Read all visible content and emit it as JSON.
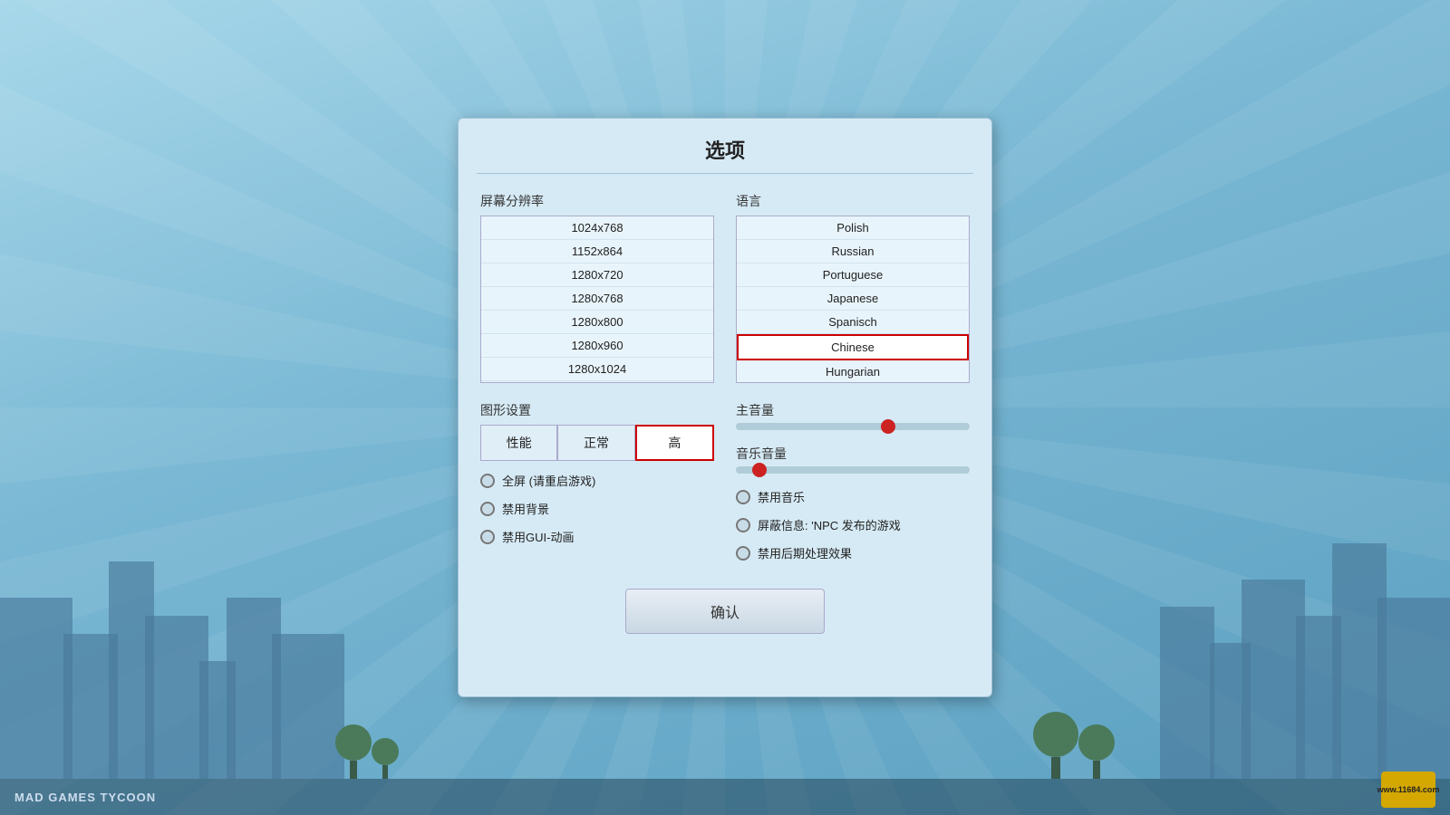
{
  "app": {
    "title": "MAD GAMES TYCOON",
    "watermark": "www.11684.com"
  },
  "dialog": {
    "title": "选项",
    "resolution_label": "屏幕分辨率",
    "language_label": "语言",
    "graphics_label": "图形设置",
    "master_volume_label": "主音量",
    "music_volume_label": "音乐音量",
    "confirm_label": "确认",
    "resolutions": [
      "1024x768",
      "1152x864",
      "1280x720",
      "1280x768",
      "1280x800",
      "1280x960",
      "1280x1024"
    ],
    "languages": [
      "Polish",
      "Russian",
      "Portuguese",
      "Japanese",
      "Spanisch",
      "Chinese",
      "Hungarian"
    ],
    "selected_language": "Chinese",
    "graphics_buttons": [
      {
        "label": "性能",
        "active": false
      },
      {
        "label": "正常",
        "active": false
      },
      {
        "label": "高",
        "active": true
      }
    ],
    "checkboxes_left": [
      "全屏 (请重启游戏)",
      "禁用背景",
      "禁用GUI-动画"
    ],
    "checkboxes_right": [
      "禁用音乐",
      "屏蔽信息: 'NPC 发布的游戏",
      "禁用后期处理效果"
    ],
    "master_volume_pct": 65,
    "music_volume_pct": 10
  }
}
